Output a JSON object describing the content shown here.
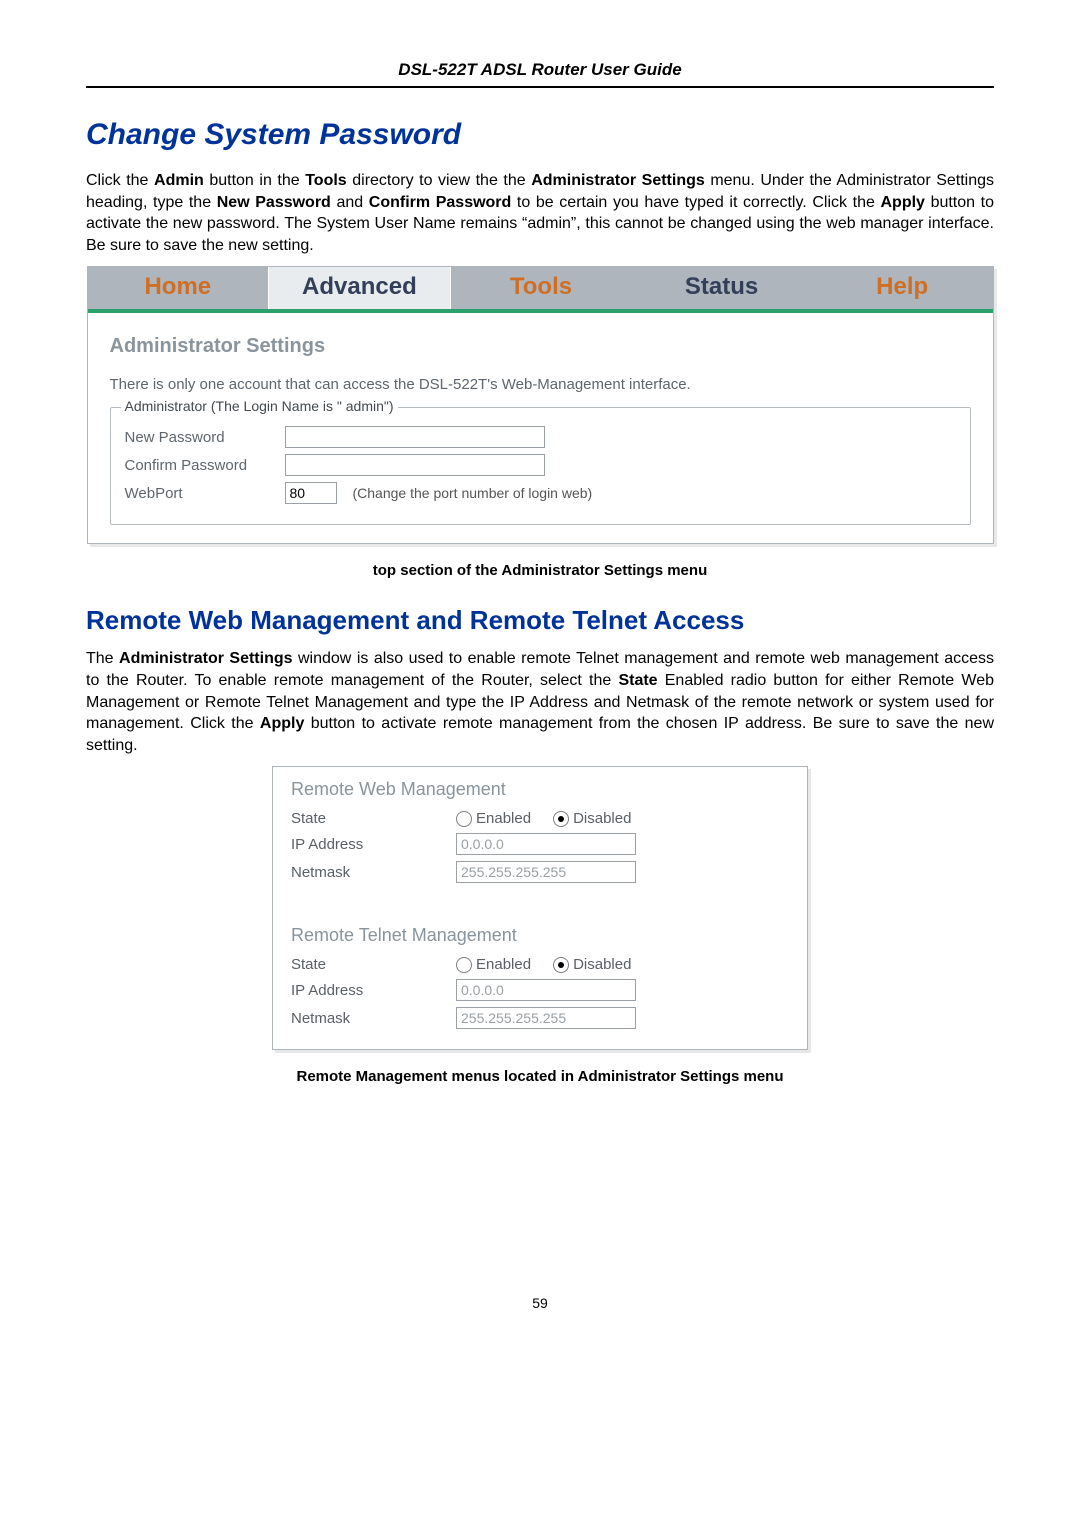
{
  "header": {
    "title": "DSL-522T ADSL Router User Guide"
  },
  "page_number": "59",
  "section1": {
    "heading": "Change System Password",
    "para": {
      "pre": "Click the ",
      "b1": "Admin",
      "t2": " button in the ",
      "b2": "Tools",
      "t3": " directory to view the the ",
      "b3": "Administrator Settings",
      "t4": " menu. Under the Administrator Settings heading, type the ",
      "b4": "New Password",
      "t5": " and ",
      "b5": "Confirm Password",
      "t6": " to be certain you have typed it correctly. Click the ",
      "b6": "Apply",
      "t7": " button to activate the new password. The System User Name remains “admin”, this cannot be changed using the web manager interface. Be sure to save the new setting."
    },
    "caption": "top section of the Administrator Settings menu"
  },
  "admin_tabs": {
    "home": "Home",
    "advanced": "Advanced",
    "tools": "Tools",
    "status": "Status",
    "help": "Help"
  },
  "admin_body": {
    "title": "Administrator Settings",
    "note": "There is only one account  that can access the DSL-522T's Web-Management interface.",
    "legend": "Administrator (The Login Name is \" admin\")",
    "new_pw_label": "New Password",
    "confirm_pw_label": "Confirm Password",
    "webport_label": "WebPort",
    "webport_value": "80",
    "webport_hint": "(Change the port number of login web)"
  },
  "section2": {
    "heading": "Remote Web Management and Remote Telnet Access",
    "para": {
      "pre": "The ",
      "b1": "Administrator Settings",
      "t2": " window is also used to enable remote Telnet management and remote web management access to the Router. To enable remote management of the Router, select the ",
      "b2": "State",
      "t3": " Enabled radio button for either Remote Web Management or Remote Telnet Management and type the IP Address and Netmask of the remote network or system used for management. Click the ",
      "b3": "Apply",
      "t4": " button to activate remote management from the chosen IP address. Be sure to save the new setting."
    },
    "caption": "Remote Management menus located in Administrator Settings menu"
  },
  "remote_web": {
    "title": "Remote Web Management",
    "state_label": "State",
    "enabled_label": "Enabled",
    "disabled_label": "Disabled",
    "ip_label": "IP Address",
    "ip_value": "0.0.0.0",
    "netmask_label": "Netmask",
    "netmask_value": "255.255.255.255"
  },
  "remote_telnet": {
    "title": "Remote Telnet Management",
    "state_label": "State",
    "enabled_label": "Enabled",
    "disabled_label": "Disabled",
    "ip_label": "IP Address",
    "ip_value": "0.0.0.0",
    "netmask_label": "Netmask",
    "netmask_value": "255.255.255.255"
  }
}
